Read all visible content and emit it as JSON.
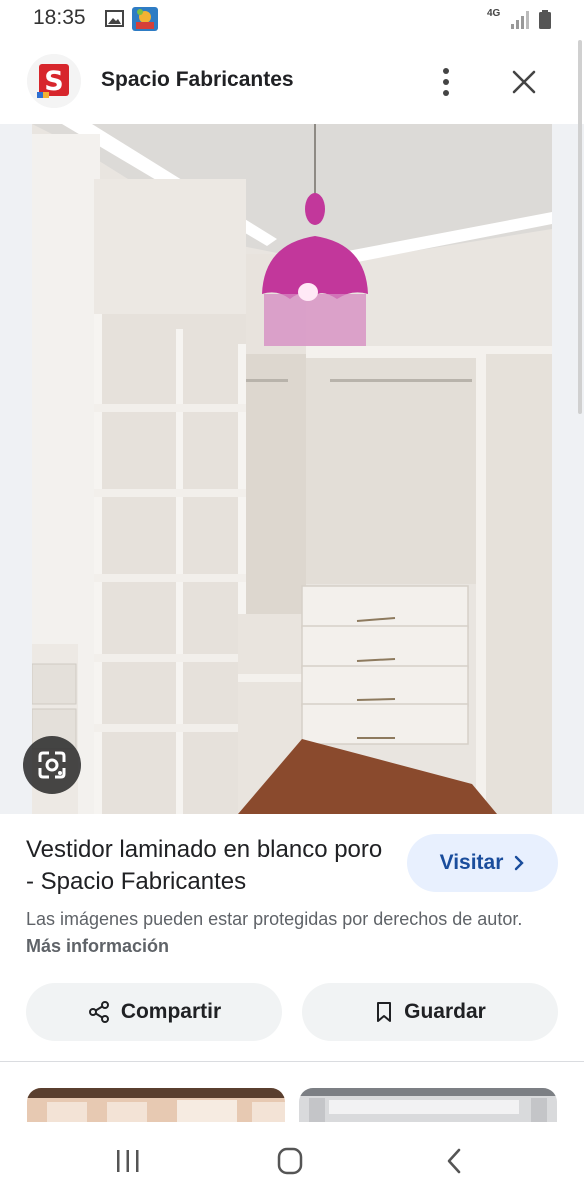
{
  "status_bar": {
    "time": "18:35",
    "network": "4G",
    "icons": [
      "gallery-icon",
      "app-notification-icon",
      "signal-icon",
      "battery-icon"
    ]
  },
  "header": {
    "site_name": "Spacio Fabricantes",
    "logo_letter": "S",
    "logo_color": "#d7262c",
    "more_icon": "more-vert-icon",
    "close_icon": "close-icon"
  },
  "image": {
    "lens_icon": "google-lens-icon"
  },
  "result": {
    "title": "Vestidor laminado en blanco poro - Spacio Fabricantes",
    "visit_label": "Visitar",
    "visit_icon": "chevron-right-icon",
    "copyright_text": "Las imágenes pueden estar protegidas por derechos de autor.",
    "more_info_label": "Más información"
  },
  "actions": {
    "share_label": "Compartir",
    "share_icon": "share-icon",
    "save_label": "Guardar",
    "save_icon": "bookmark-icon"
  },
  "nav": {
    "icons": [
      "recent-apps-icon",
      "home-icon",
      "back-icon"
    ]
  },
  "colors": {
    "visit_bg": "#e8f0fe",
    "visit_text": "#1a4d9c",
    "chip_bg": "#f1f3f4",
    "lamp": "#c2379b"
  }
}
